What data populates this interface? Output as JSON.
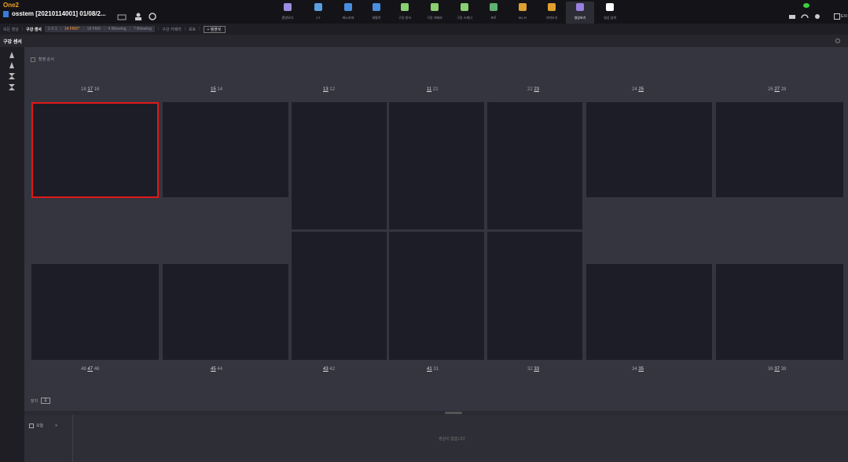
{
  "app": {
    "logo": "One2"
  },
  "patient": {
    "title": "osstem  [20210114001] 01/08/2..."
  },
  "colors": {
    "accent": "#ff9a30",
    "selection": "#e01818",
    "brand": "#f0a020"
  },
  "modules": [
    {
      "label": "환영모다",
      "icon": "globe-icon",
      "color": "#9a8ee0"
    },
    {
      "label": "CT",
      "icon": "ct-icon",
      "color": "#5aa0e0"
    },
    {
      "label": "파노라마",
      "icon": "panorama-icon",
      "color": "#4a8ee0"
    },
    {
      "label": "세팔로",
      "icon": "ceph-icon",
      "color": "#4a8ee0"
    },
    {
      "label": "구강 센서",
      "icon": "sensor-icon",
      "color": "#8ad070"
    },
    {
      "label": "구강 카메라",
      "icon": "camera-icon",
      "color": "#8ad070"
    },
    {
      "label": "구강 스캐너",
      "icon": "scanner-icon",
      "color": "#8ad070"
    },
    {
      "label": "포토",
      "icon": "photo-icon",
      "color": "#60b070"
    },
    {
      "label": "SD-FI",
      "icon": "folder-icon",
      "color": "#e0a030"
    },
    {
      "label": "가져오기",
      "icon": "import-icon",
      "color": "#e0a030"
    },
    {
      "label": "영상보기",
      "icon": "grid-icon",
      "color": "#9a7ee0",
      "active": true
    },
    {
      "label": "영상 검색",
      "icon": "search-icon",
      "color": "#ffffff"
    }
  ],
  "toolbar": {
    "all_images": "모든 영상",
    "intraoral": "구강 센서",
    "layouts": [
      "1 X 1",
      "14 FMX*",
      "18 FMX",
      "4 Bitewing",
      "7 Bitewing"
    ],
    "camera": "구강 카메라",
    "photo": "포토",
    "add_button": "+ 템플릿"
  },
  "panel": {
    "title": "구강 센서",
    "checkbox_label": "촬영 순서"
  },
  "upper_labels": [
    {
      "pre": "18 ",
      "u": "17",
      "post": " 16"
    },
    {
      "pre": "",
      "u": "15",
      "post": " 14"
    },
    {
      "pre": "",
      "u": "13",
      "post": " 12"
    },
    {
      "pre": "",
      "u": "11",
      "post": " 21"
    },
    {
      "pre": "22 ",
      "u": "23",
      "post": ""
    },
    {
      "pre": "24 ",
      "u": "25",
      "post": ""
    },
    {
      "pre": "26 ",
      "u": "27",
      "post": " 28"
    }
  ],
  "lower_labels": [
    {
      "pre": "48 ",
      "u": "47",
      "post": " 46"
    },
    {
      "pre": "",
      "u": "45",
      "post": " 44"
    },
    {
      "pre": "",
      "u": "43",
      "post": " 42"
    },
    {
      "pre": "",
      "u": "41",
      "post": " 31"
    },
    {
      "pre": "32 ",
      "u": "33",
      "post": ""
    },
    {
      "pre": "34 ",
      "u": "35",
      "post": ""
    },
    {
      "pre": "36 ",
      "u": "37",
      "post": " 38"
    }
  ],
  "footer": {
    "count_label": "장치",
    "count_value": "1"
  },
  "bottom": {
    "dropdown": "오늘",
    "empty_message": "영상이 없습니다"
  },
  "right_corner": {
    "exit": "EXI"
  }
}
